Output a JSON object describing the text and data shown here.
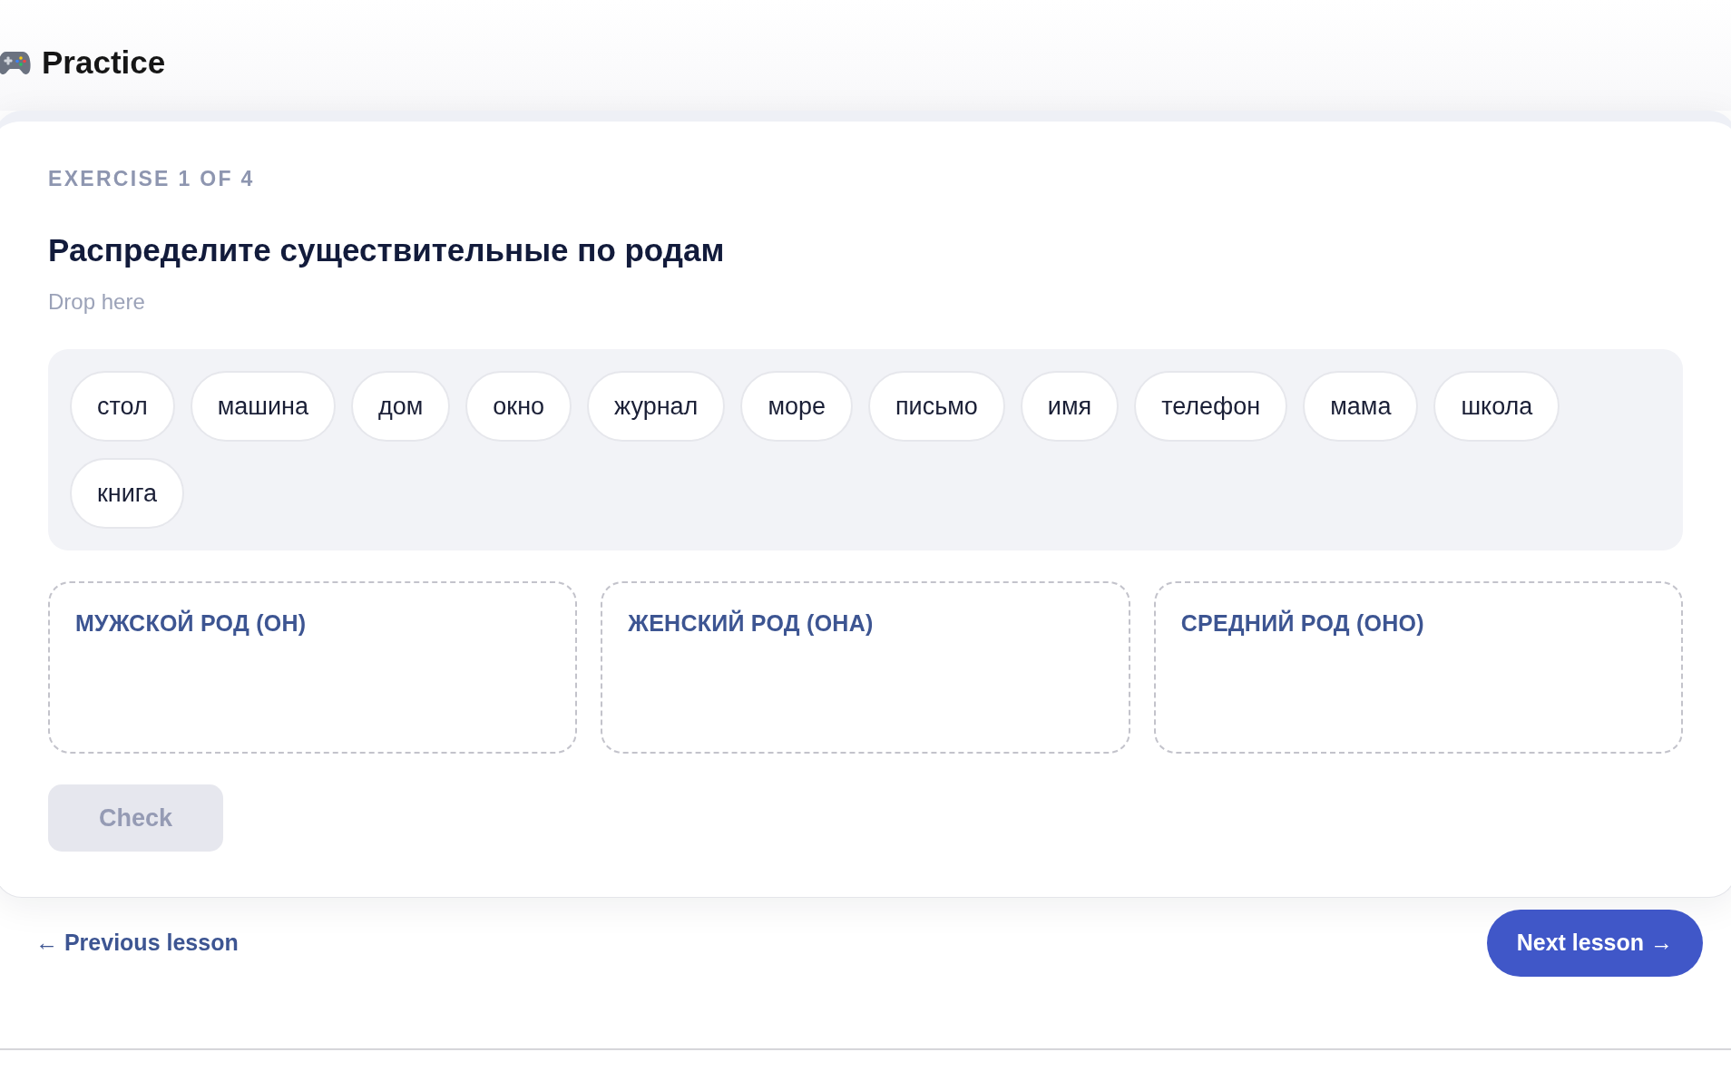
{
  "page": {
    "title": "Practice"
  },
  "exercise": {
    "counter": "EXERCISE 1 OF 4",
    "prompt": "Распределите существительные по родам",
    "hint": "Drop here",
    "word_bank": [
      "стол",
      "машина",
      "дом",
      "окно",
      "журнал",
      "море",
      "письмо",
      "имя",
      "телефон",
      "мама",
      "школа",
      "книга"
    ],
    "drop_zones": [
      {
        "label": "МУЖСКОЙ РОД (ОН)"
      },
      {
        "label": "ЖЕНСКИЙ РОД (ОНА)"
      },
      {
        "label": "СРЕДНИЙ РОД (ОНО)"
      }
    ],
    "check_button": {
      "label": "Check",
      "disabled": true
    }
  },
  "navigation": {
    "previous": "← Previous lesson",
    "next": "Next lesson →"
  }
}
